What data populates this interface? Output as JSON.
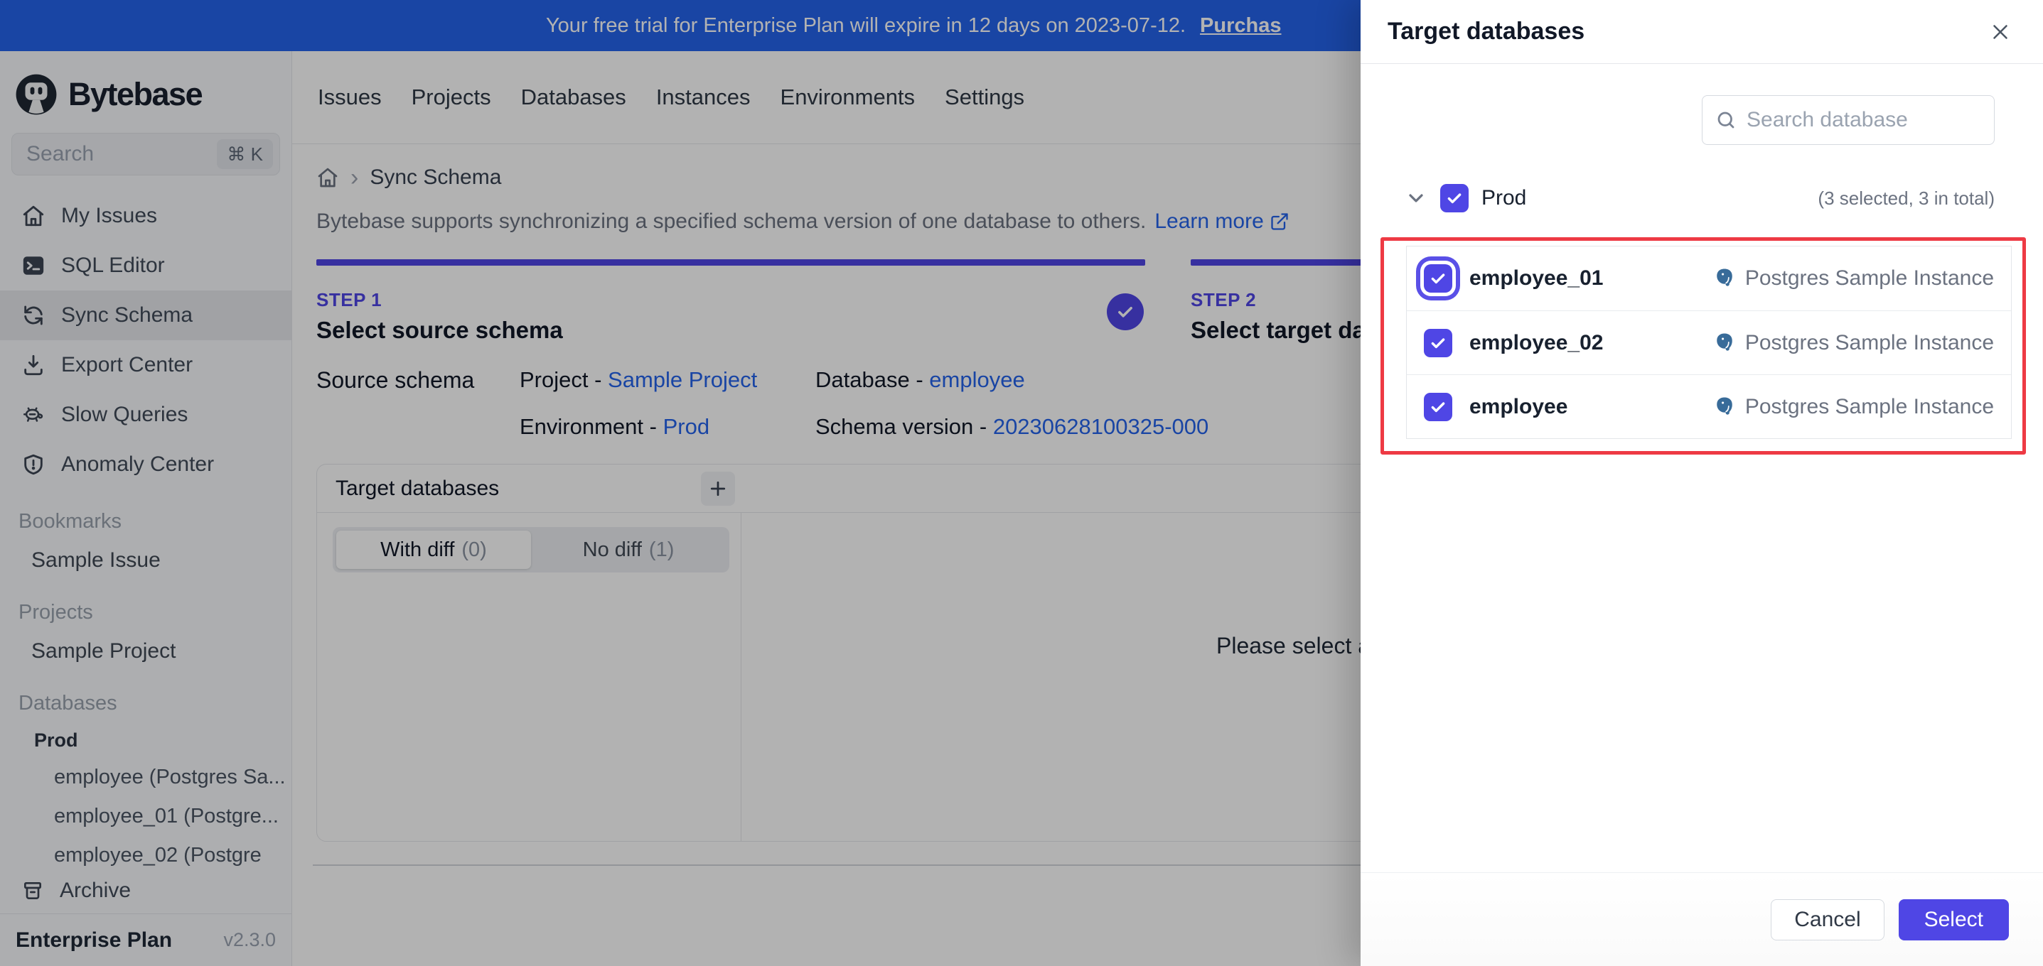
{
  "banner": {
    "message": "Your free trial for Enterprise Plan will expire in 12 days on 2023-07-12.",
    "link_label": "Purchas",
    "background": "#2563eb"
  },
  "topnav": {
    "items": [
      "Issues",
      "Projects",
      "Databases",
      "Instances",
      "Environments",
      "Settings"
    ]
  },
  "sidebar": {
    "logo_text": "Bytebase",
    "search": {
      "placeholder": "Search",
      "shortcut": "⌘ K"
    },
    "nav": [
      {
        "label": "My Issues",
        "icon": "home-icon"
      },
      {
        "label": "SQL Editor",
        "icon": "terminal-icon"
      },
      {
        "label": "Sync Schema",
        "icon": "sync-icon"
      },
      {
        "label": "Export Center",
        "icon": "download-icon"
      },
      {
        "label": "Slow Queries",
        "icon": "turtle-icon"
      },
      {
        "label": "Anomaly Center",
        "icon": "shield-icon"
      }
    ],
    "bookmarks": {
      "header": "Bookmarks",
      "item": "Sample Issue"
    },
    "projects": {
      "header": "Projects",
      "item": "Sample Project"
    },
    "databases": {
      "header": "Databases",
      "group": "Prod",
      "items": [
        "employee (Postgres Sa...",
        "employee_01 (Postgre...",
        "employee_02 (Postgre"
      ]
    },
    "archive_label": "Archive",
    "footer": {
      "plan": "Enterprise Plan",
      "version": "v2.3.0"
    }
  },
  "main": {
    "breadcrumb": {
      "page": "Sync Schema",
      "separator": "›"
    },
    "description": "Bytebase supports synchronizing a specified schema version of one database to others.",
    "learn_more": "Learn more",
    "steps": {
      "step1": {
        "label": "STEP 1",
        "title": "Select source schema"
      },
      "step2": {
        "label": "STEP 2",
        "title": "Select target datab"
      }
    },
    "source_schema": {
      "label": "Source schema",
      "project_label": "Project - ",
      "project_value": "Sample Project",
      "database_label": "Database - ",
      "database_value": "employee",
      "environment_label": "Environment - ",
      "environment_value": "Prod",
      "schema_version_label": "Schema version - ",
      "schema_version_value": "20230628100325-000"
    },
    "panel": {
      "title": "Target databases",
      "tabs": [
        {
          "label": "With diff",
          "count": "(0)"
        },
        {
          "label": "No diff",
          "count": "(1)"
        }
      ],
      "placeholder": "Please select a t"
    }
  },
  "drawer": {
    "title": "Target databases",
    "search_placeholder": "Search database",
    "group": {
      "name": "Prod",
      "summary": "(3 selected, 3 in total)"
    },
    "databases": [
      {
        "name": "employee_01",
        "instance": "Postgres Sample Instance"
      },
      {
        "name": "employee_02",
        "instance": "Postgres Sample Instance"
      },
      {
        "name": "employee",
        "instance": "Postgres Sample Instance"
      }
    ],
    "cancel_label": "Cancel",
    "select_label": "Select",
    "accent": "#4f46e5"
  },
  "annotation": {
    "color": "#ee3a44"
  }
}
